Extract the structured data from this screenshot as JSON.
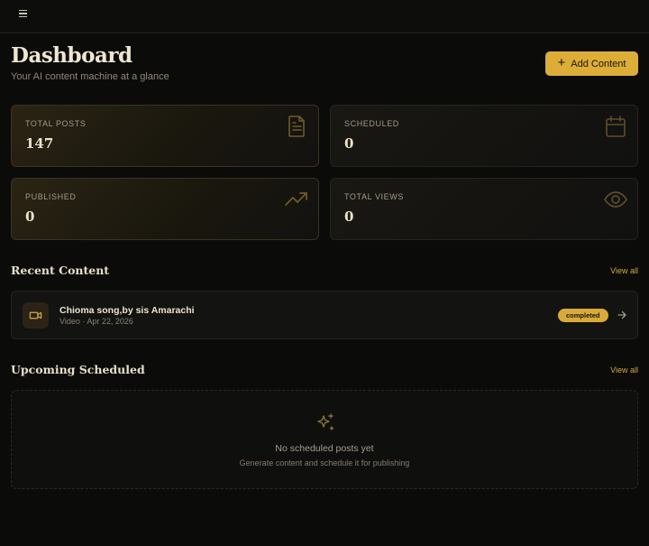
{
  "header": {
    "menu_icon": "hamburger-menu-icon"
  },
  "page": {
    "title": "Dashboard",
    "subtitle": "Your AI content machine at a glance",
    "add_button_label": "Add Content"
  },
  "colors": {
    "accent": "#dcae38",
    "background": "#0b0b0a"
  },
  "stats": [
    {
      "label": "TOTAL POSTS",
      "value": "147",
      "icon": "document-icon"
    },
    {
      "label": "SCHEDULED",
      "value": "0",
      "icon": "calendar-icon"
    },
    {
      "label": "PUBLISHED",
      "value": "0",
      "icon": "trending-up-icon"
    },
    {
      "label": "TOTAL VIEWS",
      "value": "0",
      "icon": "eye-icon"
    }
  ],
  "recent": {
    "title": "Recent Content",
    "view_all": "View all",
    "items": [
      {
        "title": "Chioma song,by sis Amarachi",
        "meta": "Video · Apr 22, 2026",
        "status": "completed",
        "icon": "video-camera-icon"
      }
    ]
  },
  "upcoming": {
    "title": "Upcoming Scheduled",
    "view_all": "View all",
    "empty_title": "No scheduled posts yet",
    "empty_subtitle": "Generate content and schedule it for publishing",
    "empty_icon": "sparkles-icon"
  }
}
